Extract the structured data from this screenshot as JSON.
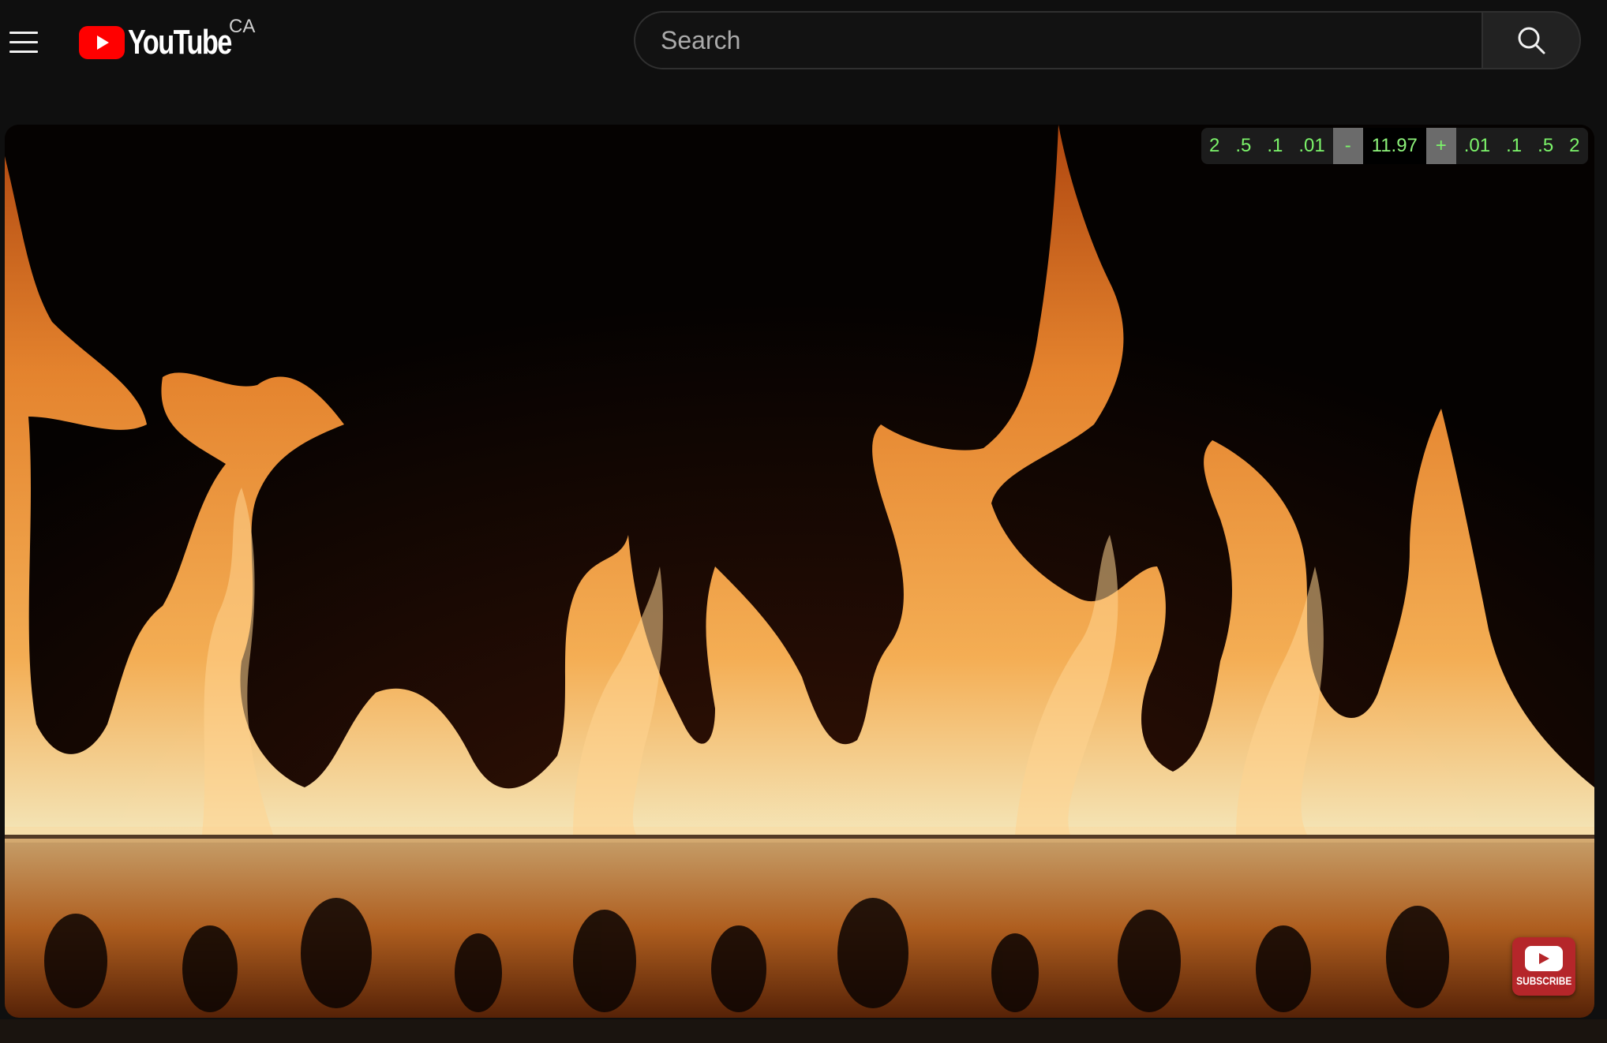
{
  "header": {
    "logo_text": "YouTube",
    "country_code": "CA",
    "menu_icon": "hamburger-menu-icon",
    "logo_icon": "youtube-play-icon"
  },
  "search": {
    "placeholder": "Search",
    "value": "",
    "button_icon": "search-icon"
  },
  "speed_control": {
    "decrease_steps": [
      "2",
      ".5",
      ".1",
      ".01"
    ],
    "minus_label": "-",
    "current_value": "11.97",
    "plus_label": "+",
    "increase_steps": [
      ".01",
      ".1",
      ".5",
      "2"
    ],
    "text_color": "#7cf46a"
  },
  "subscribe": {
    "label": "SUBSCRIBE",
    "icon": "youtube-play-icon",
    "color": "#b5262a"
  },
  "video": {
    "content": "flames"
  },
  "colors": {
    "brand_red": "#ff0000",
    "background": "#0f0f0f"
  }
}
